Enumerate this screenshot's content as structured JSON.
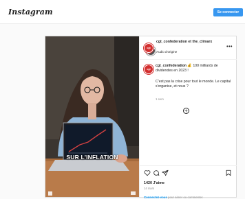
{
  "topbar": {
    "logo_text": "Instagram",
    "connect_label": "Se connecter"
  },
  "post": {
    "media": {
      "caption_overlay": "SUR L'INFLATION"
    },
    "header": {
      "usernames": "cgt_confederation et the_climarx",
      "audio": "Audio d'origine",
      "more_icon": "more-horizontal-icon"
    },
    "caption": {
      "username": "cgt_confederation",
      "emoji": "💰",
      "headline": "100 milliards de dividendes en 2023 !",
      "body": "C'est pas la crise pour tout le monde. Le capital s'organise, et nous ?",
      "time": "1 sem"
    },
    "avatar_text": "cgt",
    "likes": "1420 J'aime",
    "date": "14 mars",
    "login_prompt": {
      "link": "Connectez-vous",
      "rest": "pour aimer ou commenter."
    }
  },
  "colors": {
    "accent": "#3797f0",
    "brand_red": "#d32f2f"
  }
}
